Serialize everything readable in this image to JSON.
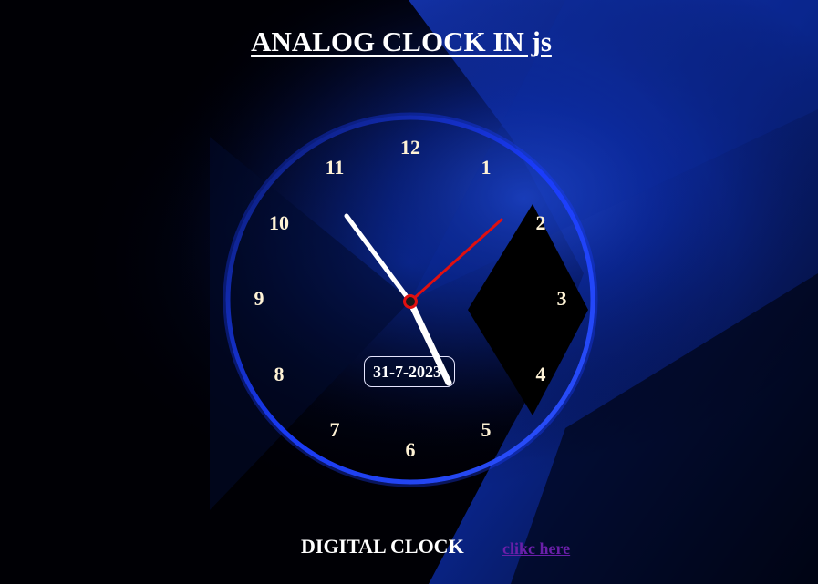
{
  "page": {
    "title": "ANALOG CLOCK IN js"
  },
  "clock": {
    "numbers": [
      "12",
      "1",
      "2",
      "3",
      "4",
      "5",
      "6",
      "7",
      "8",
      "9",
      "10",
      "11"
    ],
    "date": "31-7-2023",
    "hour_hand_color": "#ffffff",
    "minute_hand_color": "#ffffff",
    "second_hand_color": "#e01010",
    "ring_color": "#1a3cff",
    "number_color": "#fff3d6"
  },
  "footer": {
    "label": "DIGITAL CLOCK",
    "link_text": "clikc here",
    "link_color": "#6a1fa8"
  },
  "background": {
    "base_color": "#000000",
    "accent_color": "#1a4dff"
  }
}
